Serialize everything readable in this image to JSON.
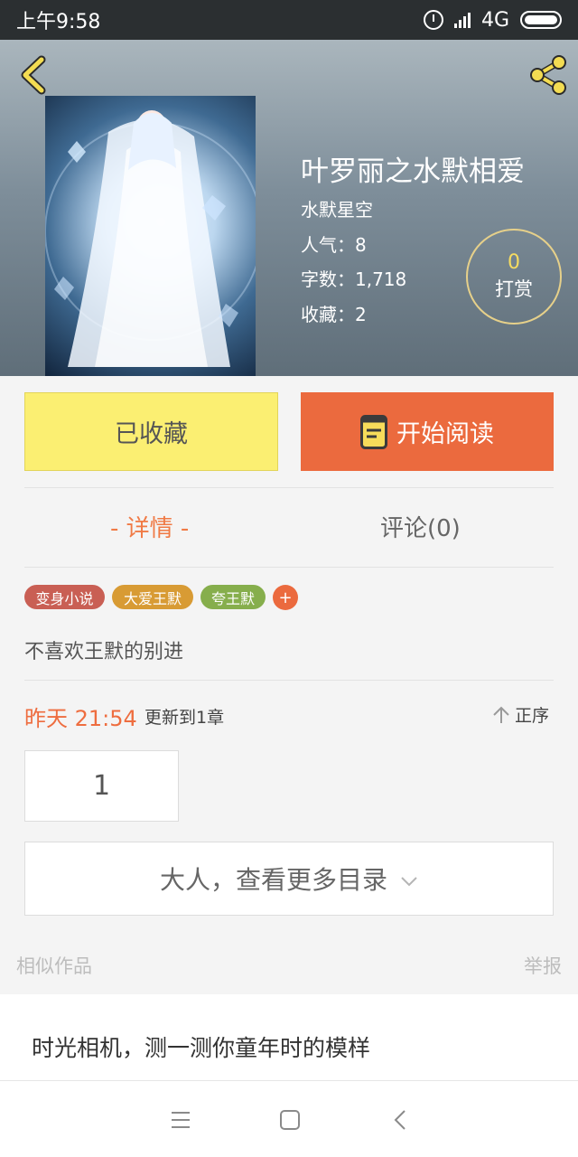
{
  "status_bar": {
    "time": "上午9:58",
    "network": "4G"
  },
  "book": {
    "title": "叶罗丽之水默相爱",
    "author": "水默星空",
    "popularity_label": "人气：",
    "popularity": "8",
    "word_count_label": "字数：",
    "word_count": "1,718",
    "favorites_label": "收藏：",
    "favorites": "2"
  },
  "reward": {
    "count": "0",
    "label": "打赏"
  },
  "actions": {
    "favorite_label": "已收藏",
    "read_label": "开始阅读"
  },
  "tabs": {
    "details": "- 详情 -",
    "comments": "评论(0)"
  },
  "tags": [
    "变身小说",
    "大爱王默",
    "夸王默"
  ],
  "tag_add": "+",
  "synopsis": "不喜欢王默的别进",
  "update": {
    "time": "昨天 21:54",
    "text": "更新到1章",
    "sort_label": "正序"
  },
  "chapter_number": "1",
  "more_catalog_label": "大人，查看更多目录",
  "similar": {
    "label": "相似作品",
    "report": "举报",
    "first_title": "时光相机，测一测你童年时的模样"
  },
  "colors": {
    "accent": "#eb6a3e",
    "favorite_button": "#fbef72",
    "status_bar": "#2b2f31"
  }
}
